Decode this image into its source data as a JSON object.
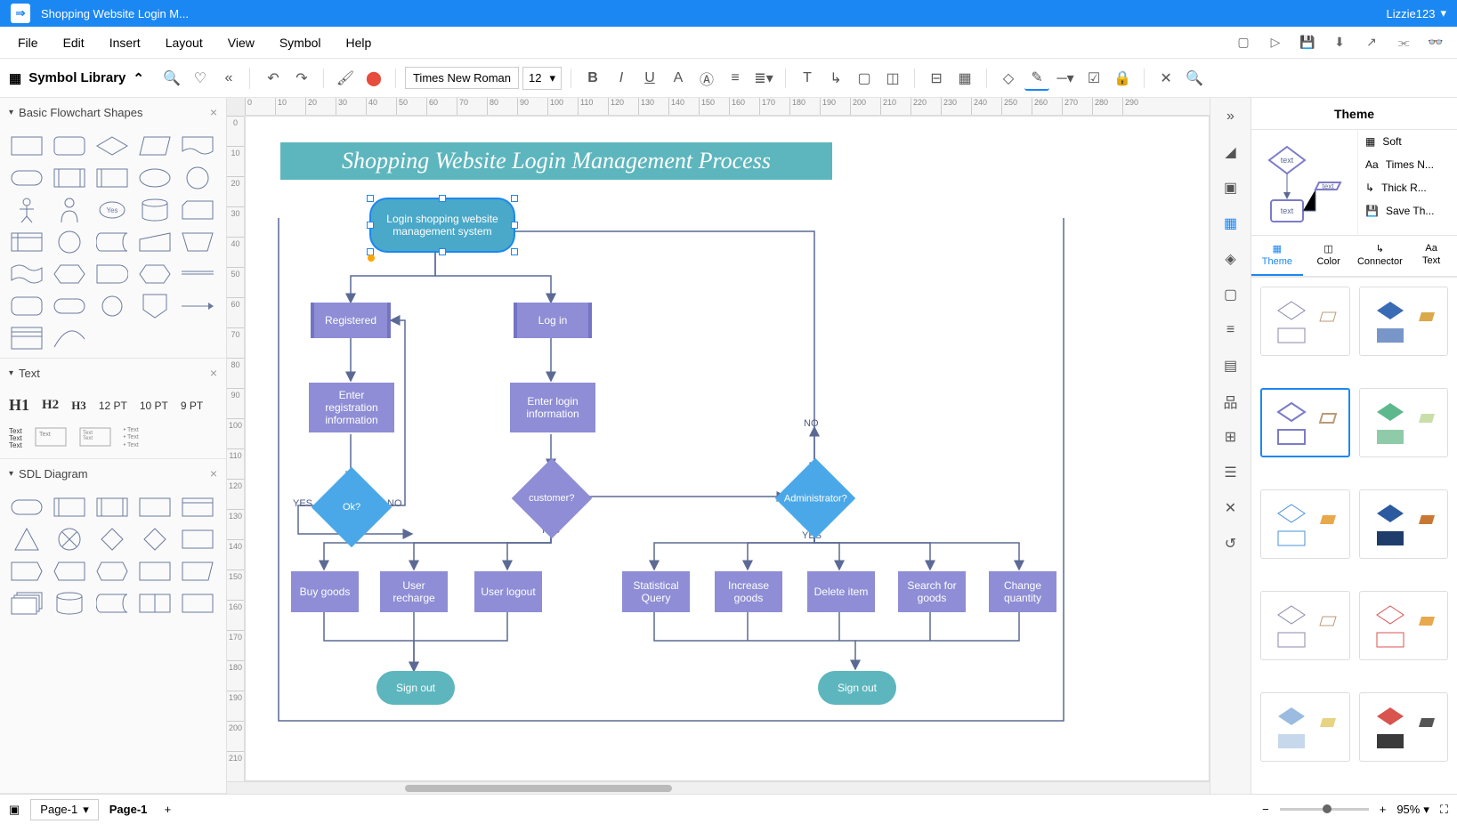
{
  "titlebar": {
    "title": "Shopping Website Login M...",
    "user": "Lizzie123"
  },
  "menu": {
    "items": [
      "File",
      "Edit",
      "Insert",
      "Layout",
      "View",
      "Symbol",
      "Help"
    ]
  },
  "symbol_library_label": "Symbol Library",
  "toolbar": {
    "font": "Times New Roman",
    "size": "12"
  },
  "libs": {
    "flowchart": "Basic Flowchart Shapes",
    "text": "Text",
    "sdl": "SDL Diagram",
    "h1": "H1",
    "h2": "H2",
    "h3": "H3",
    "pt12": "12 PT",
    "pt10": "10 PT",
    "pt9": "9 PT"
  },
  "ruler_h": [
    "0",
    "10",
    "20",
    "30",
    "40",
    "50",
    "60",
    "70",
    "80",
    "90",
    "100",
    "110",
    "120",
    "130",
    "140",
    "150",
    "160",
    "170",
    "180",
    "190",
    "200",
    "210",
    "220",
    "230",
    "240",
    "250",
    "260",
    "270",
    "280",
    "290"
  ],
  "ruler_v": [
    "0",
    "10",
    "20",
    "30",
    "40",
    "50",
    "60",
    "70",
    "80",
    "90",
    "100",
    "110",
    "120",
    "130",
    "140",
    "150",
    "160",
    "170",
    "180",
    "190",
    "200",
    "210"
  ],
  "diagram": {
    "title": "Shopping Website Login Management Process",
    "n1": "Login shopping website management system",
    "registered": "Registered",
    "login": "Log in",
    "enter_reg": "Enter registration information",
    "enter_login": "Enter login information",
    "ok": "Ok?",
    "customer": "customer?",
    "admin": "Administrator?",
    "buy": "Buy goods",
    "recharge": "User recharge",
    "logout": "User logout",
    "stat": "Statistical Query",
    "increase": "Increase goods",
    "delete": "Delete item",
    "search": "Search for goods",
    "change": "Change quantity",
    "signout": "Sign out",
    "yes": "YES",
    "no": "NO"
  },
  "theme": {
    "title": "Theme",
    "soft": "Soft",
    "font": "Times N...",
    "thick": "Thick R...",
    "save": "Save Th...",
    "tabs": {
      "theme": "Theme",
      "color": "Color",
      "connector": "Connector",
      "text": "Text"
    },
    "preview": {
      "t1": "text",
      "t2": "text",
      "t3": "text"
    }
  },
  "status": {
    "page_sel": "Page-1",
    "page_current": "Page-1",
    "zoom": "95%"
  }
}
